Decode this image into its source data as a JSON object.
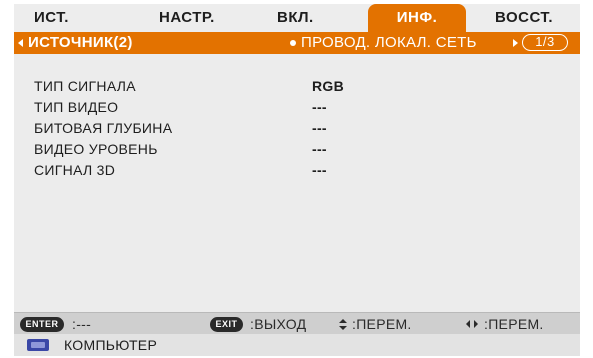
{
  "tabs": [
    {
      "label": "ИСТ."
    },
    {
      "label": "НАСТР."
    },
    {
      "label": "ВКЛ."
    },
    {
      "label": "ИНФ."
    },
    {
      "label": "ВОССТ."
    }
  ],
  "active_tab": "ИНФ.",
  "header": {
    "title": "ИСТОЧНИК(2)",
    "next_tab": "ПРОВОД. ЛОКАЛ. СЕТЬ",
    "page": "1/3"
  },
  "info_rows": [
    {
      "label": "ТИП СИГНАЛА",
      "value": "RGB"
    },
    {
      "label": "ТИП ВИДЕО",
      "value": "---"
    },
    {
      "label": "БИТОВАЯ ГЛУБИНА",
      "value": "---"
    },
    {
      "label": "ВИДЕО УРОВЕНЬ",
      "value": "---"
    },
    {
      "label": "СИГНАЛ 3D",
      "value": "---"
    }
  ],
  "footer": {
    "enter_key": "ENTER",
    "enter_action": ":---",
    "exit_key": "EXIT",
    "exit_action": ":ВЫХОД",
    "updown_action": ":ПЕРЕМ.",
    "leftright_action": ":ПЕРЕМ."
  },
  "source": {
    "icon": "computer-icon",
    "label": "КОМПЬЮТЕР"
  },
  "colors": {
    "accent": "#e37200",
    "panel": "#ececec",
    "footer": "#cfcfcf",
    "text": "#1e1e1e"
  }
}
